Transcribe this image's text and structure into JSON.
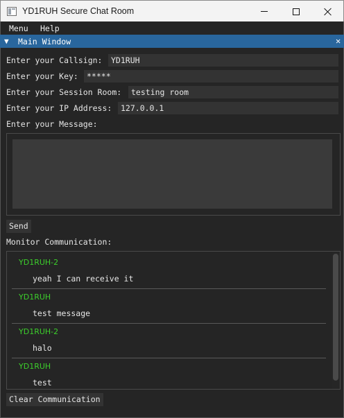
{
  "window": {
    "title": "YD1RUH Secure Chat Room",
    "icon": "chat-app-icon"
  },
  "menubar": {
    "items": [
      "Menu",
      "Help"
    ]
  },
  "panel": {
    "title": "Main Window",
    "collapse_icon": "triangle-down-icon",
    "close_icon": "close-icon"
  },
  "form": {
    "callsign_label": "Enter your Callsign:",
    "callsign_value": "YD1RUH",
    "key_label": "Enter your Key:",
    "key_value": "*****",
    "session_label": "Enter your Session Room:",
    "session_value": "testing room",
    "ip_label": "Enter your IP Address:",
    "ip_value": "127.0.0.1",
    "message_label": "Enter your Message:",
    "message_value": ""
  },
  "send_label": "Send",
  "monitor": {
    "label": "Monitor Communication:",
    "messages": [
      {
        "sender": "YD1RUH-2",
        "text": "yeah I can receive it"
      },
      {
        "sender": "YD1RUH",
        "text": "test message"
      },
      {
        "sender": "YD1RUH-2",
        "text": "halo"
      },
      {
        "sender": "YD1RUH",
        "text": "test"
      }
    ]
  },
  "clear_label": "Clear Communication",
  "colors": {
    "accent": "#29669d",
    "sender": "#3ccf2b",
    "background": "#252525",
    "field": "#333333"
  }
}
